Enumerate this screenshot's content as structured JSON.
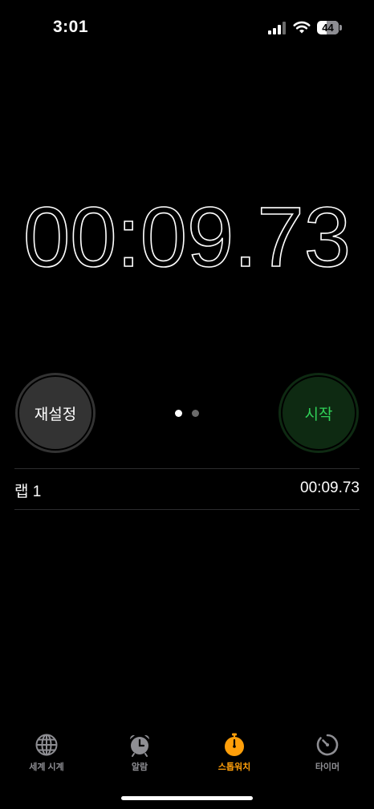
{
  "status_bar": {
    "time": "3:01",
    "battery_level": "44",
    "battery_fraction": 0.44,
    "signal_icon": "cellular-signal-icon",
    "wifi_icon": "wifi-icon"
  },
  "stopwatch": {
    "display": "00:09.73"
  },
  "controls": {
    "reset_label": "재설정",
    "start_label": "시작",
    "page_count": 2,
    "active_page": 1,
    "reset_color": "#333333",
    "start_color": "#0e2a12",
    "start_text_color": "#30d158"
  },
  "laps": [
    {
      "label": "랩 1",
      "time": "00:09.73"
    }
  ],
  "tab_bar": {
    "items": [
      {
        "label": "세계 시계",
        "icon": "globe-icon",
        "active": false
      },
      {
        "label": "알람",
        "icon": "alarm-clock-icon",
        "active": false
      },
      {
        "label": "스톱워치",
        "icon": "stopwatch-icon",
        "active": true
      },
      {
        "label": "타이머",
        "icon": "timer-icon",
        "active": false
      }
    ],
    "active_color": "#ff9f0a",
    "inactive_color": "#8e8e93"
  }
}
